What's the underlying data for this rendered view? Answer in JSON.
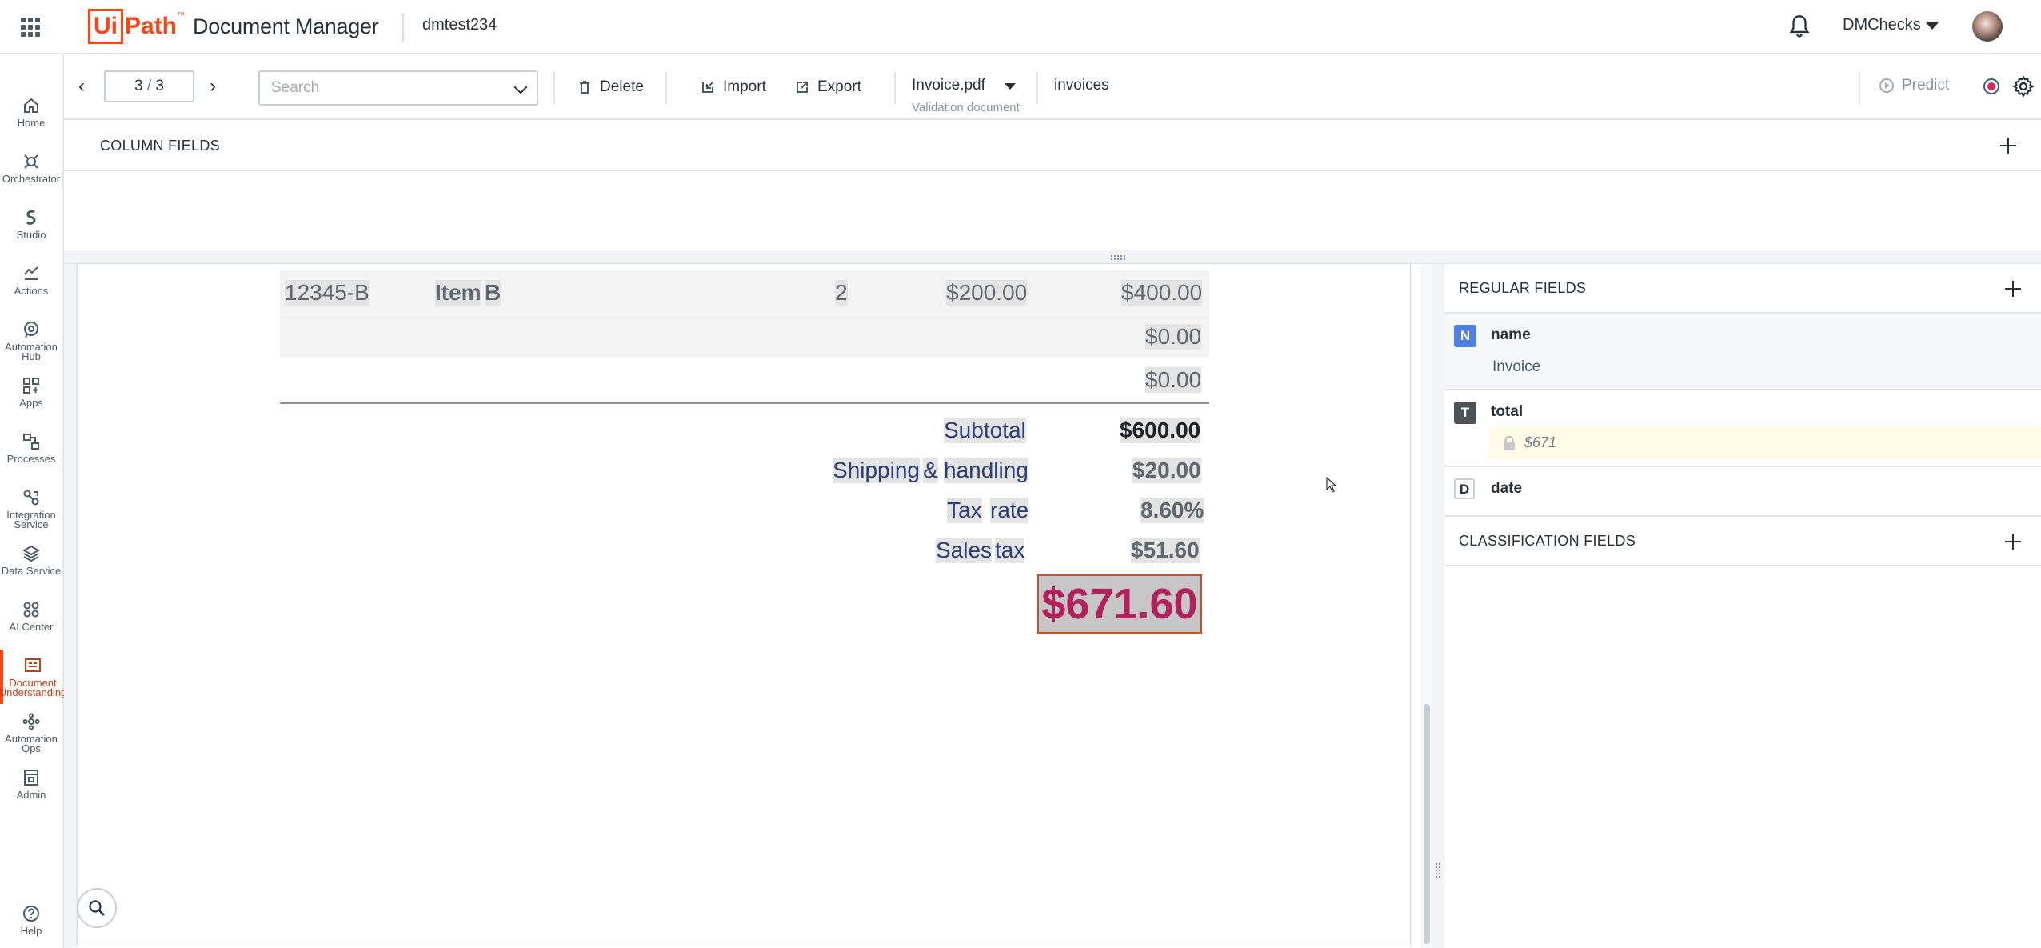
{
  "header": {
    "logo_mark": "Ui",
    "logo_path": "Path",
    "logo_tm": "™",
    "product": "Document Manager",
    "tenant": "dmtest234",
    "org": "DMChecks"
  },
  "nav": [
    {
      "label": "Home",
      "icon": "home-icon"
    },
    {
      "label": "Orchestrator",
      "icon": "orchestrator-icon"
    },
    {
      "label": "Studio",
      "icon": "studio-icon"
    },
    {
      "label": "Actions",
      "icon": "actions-icon"
    },
    {
      "label": "Automation Hub",
      "icon": "automation-hub-icon"
    },
    {
      "label": "Apps",
      "icon": "apps-icon"
    },
    {
      "label": "Processes",
      "icon": "processes-icon"
    },
    {
      "label": "Integration Service",
      "icon": "integration-service-icon"
    },
    {
      "label": "Data Service",
      "icon": "data-service-icon"
    },
    {
      "label": "AI Center",
      "icon": "ai-center-icon"
    },
    {
      "label": "Document Understanding",
      "icon": "document-understanding-icon"
    },
    {
      "label": "Automation Ops",
      "icon": "automation-ops-icon"
    },
    {
      "label": "Admin",
      "icon": "admin-icon"
    },
    {
      "label": "Help",
      "icon": "help-icon"
    }
  ],
  "toolbar": {
    "page_current": "3",
    "page_sep": "/",
    "page_total": "3",
    "search_placeholder": "Search",
    "delete_label": "Delete",
    "import_label": "Import",
    "export_label": "Export",
    "document_name": "Invoice.pdf",
    "document_subtitle": "Validation document",
    "document_type": "invoices",
    "predict_label": "Predict"
  },
  "column_fields": {
    "title": "COLUMN FIELDS"
  },
  "document": {
    "item_row": {
      "code": "12345-B",
      "name_a": "Item",
      "name_b": "B",
      "qty": "2",
      "price": "$200.00",
      "amount": "$400.00"
    },
    "empty_row_1": "$0.00",
    "empty_row_2": "$0.00",
    "subtotal_label": "Subtotal",
    "subtotal_value": "$600.00",
    "shipping_label_a": "Shipping",
    "shipping_label_b": "&",
    "shipping_label_c": "handling",
    "shipping_value": "$20.00",
    "taxrate_label_a": "Tax",
    "taxrate_label_b": "rate",
    "taxrate_value": "8.60%",
    "salestax_label_a": "Sales",
    "salestax_label_b": "tax",
    "salestax_value": "$51.60",
    "grand_total": "$671.60"
  },
  "regular_fields": {
    "title": "REGULAR FIELDS",
    "fields": [
      {
        "type": "N",
        "name": "name",
        "value": "Invoice",
        "color": "#4f7fe0"
      },
      {
        "type": "T",
        "name": "total",
        "value": "$671",
        "color": "#4b5358"
      },
      {
        "type": "D",
        "name": "date",
        "value": "",
        "color": "#ffffff"
      }
    ]
  },
  "classification_fields": {
    "title": "CLASSIFICATION FIELDS"
  },
  "colors": {
    "brand": "#fa4616",
    "highlight_border": "#c8512d",
    "grand_total_text": "#b2215e",
    "record_dot": "#e0245e"
  }
}
